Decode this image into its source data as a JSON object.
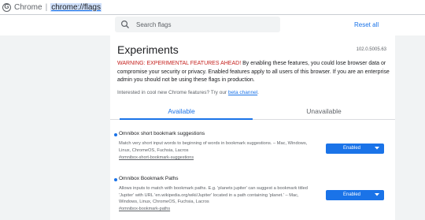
{
  "omnibox": {
    "site_label": "Chrome",
    "separator": "|",
    "url": "chrome://flags"
  },
  "header": {
    "search_placeholder": "Search flags",
    "reset_label": "Reset all"
  },
  "main": {
    "title": "Experiments",
    "version": "102.0.5005.63",
    "warning_strong": "WARNING: EXPERIMENTAL FEATURES AHEAD!",
    "warning_rest": " By enabling these features, you could lose browser data or compromise your security or privacy. Enabled features apply to all users of this browser. If you are an enterprise admin you should not be using these flags in production.",
    "interest_text": "Interested in cool new Chrome features? Try our ",
    "beta_link": "beta channel",
    "interest_end": ".",
    "tabs": [
      {
        "label": "Available",
        "active": true
      },
      {
        "label": "Unavailable",
        "active": false
      }
    ],
    "flags": [
      {
        "name": "Omnibox short bookmark suggestions",
        "description": "Match very short input words to beginning of words in bookmark suggestions. – Mac, Windows, Linux, ChromeOS, Fuchsia, Lacros",
        "anchor": "#omnibox-short-bookmark-suggestions",
        "value": "Enabled"
      },
      {
        "name": "Omnibox Bookmark Paths",
        "description": "Allows inputs to match with bookmark paths. E.g. 'planets jupiter' can suggest a bookmark titled 'Jupiter' with URL 'en.wikipedia.org/wiki/Jupiter' located in a path containing 'planet.' – Mac, Windows, Linux, ChromeOS, Fuchsia, Lacros",
        "anchor": "#omnibox-bookmark-paths",
        "value": "Enabled"
      }
    ]
  },
  "colors": {
    "accent": "#1a73e8",
    "warning": "#c5221f",
    "page_bg": "#f1f3f4"
  }
}
